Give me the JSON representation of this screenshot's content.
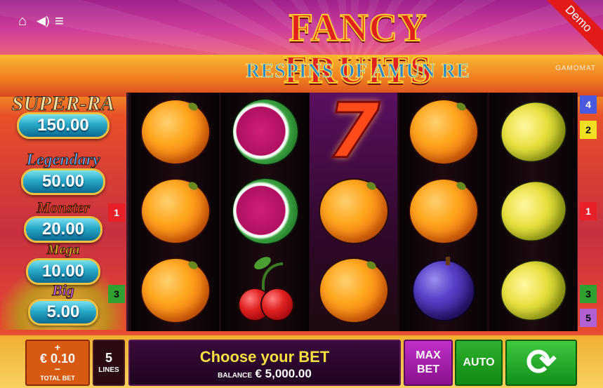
{
  "window": {
    "demo_label": "Demo",
    "brand": "GAMOMAT"
  },
  "top_icons": [
    {
      "name": "home-icon",
      "glyph": "⌂"
    },
    {
      "name": "sound-icon",
      "glyph": "🔊"
    },
    {
      "name": "menu-icon",
      "glyph": "≡"
    }
  ],
  "title": {
    "main": "FANCY FRUITS",
    "sub": "RESPINS OF AMUN RE"
  },
  "jackpots": [
    {
      "label": "SUPER-RA",
      "value": "150.00",
      "color": "#f0e0a0"
    },
    {
      "label": "Legendary",
      "value": "50.00",
      "color": "#60a0f0"
    },
    {
      "label": "Monster",
      "value": "20.00",
      "color": "#e84020"
    },
    {
      "label": "Mega",
      "value": "10.00",
      "color": "#f0c020"
    },
    {
      "label": "Big",
      "value": "5.00",
      "color": "#c060e0"
    }
  ],
  "reels": [
    [
      "orange",
      "orange",
      "orange"
    ],
    [
      "melon",
      "melon",
      "cherry"
    ],
    [
      "seven",
      "orange",
      "orange"
    ],
    [
      "orange",
      "orange",
      "plum"
    ],
    [
      "lemon",
      "lemon",
      "lemon"
    ]
  ],
  "line_indicators": {
    "left": [
      {
        "label": "1",
        "bg": "#e8202a",
        "fg": "#ffffff"
      },
      {
        "label": "3",
        "bg": "#30a030",
        "fg": "#000000"
      }
    ],
    "right": [
      {
        "label": "4",
        "bg": "#4a5ae0",
        "fg": "#ffffff"
      },
      {
        "label": "2",
        "bg": "#f0e020",
        "fg": "#000000"
      },
      {
        "label": "1",
        "bg": "#e8202a",
        "fg": "#ffffff"
      },
      {
        "label": "3",
        "bg": "#30a030",
        "fg": "#000000"
      },
      {
        "label": "5",
        "bg": "#b060d0",
        "fg": "#000000"
      }
    ]
  },
  "bottom": {
    "bet_plus": "+",
    "bet_value": "€ 0.10",
    "bet_minus": "−",
    "bet_label": "TOTAL BET",
    "lines_value": "5",
    "lines_label": "LINES",
    "message": "Choose your BET",
    "balance_label": "BALANCE",
    "balance_value": "€ 5,000.00",
    "max_bet_line1": "MAX",
    "max_bet_line2": "BET",
    "auto_label": "AUTO",
    "spin_icon": "⟳"
  }
}
